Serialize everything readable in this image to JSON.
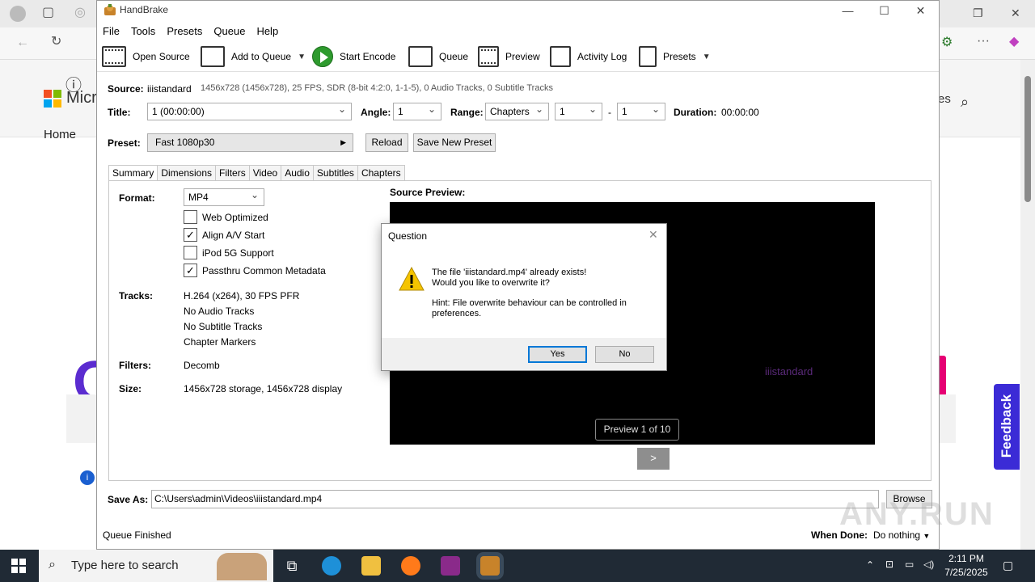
{
  "browser": {
    "home_link": "Home",
    "ms_text": "Micr",
    "es_text": "es",
    "feedback": "Feedback"
  },
  "window": {
    "title": "HandBrake"
  },
  "menu": [
    "File",
    "Tools",
    "Presets",
    "Queue",
    "Help"
  ],
  "toolbar": {
    "open_source": "Open Source",
    "add_to_queue": "Add to Queue",
    "start_encode": "Start Encode",
    "queue": "Queue",
    "preview": "Preview",
    "activity_log": "Activity Log",
    "presets": "Presets"
  },
  "source": {
    "label": "Source:",
    "name": "iiistandard",
    "details": "1456x728 (1456x728), 25 FPS, SDR (8-bit 4:2:0, 1-1-5), 0 Audio Tracks, 0 Subtitle Tracks"
  },
  "title_row": {
    "title_label": "Title:",
    "title_value": "1  (00:00:00)",
    "angle_label": "Angle:",
    "angle_value": "1",
    "range_label": "Range:",
    "range_value": "Chapters",
    "range_start": "1",
    "range_sep": "-",
    "range_end": "1",
    "duration_label": "Duration:",
    "duration_value": "00:00:00"
  },
  "preset": {
    "label": "Preset:",
    "value": "Fast 1080p30",
    "reload": "Reload",
    "save_new": "Save New Preset"
  },
  "tabs": [
    "Summary",
    "Dimensions",
    "Filters",
    "Video",
    "Audio",
    "Subtitles",
    "Chapters"
  ],
  "summary": {
    "format_label": "Format:",
    "format_value": "MP4",
    "checkboxes": [
      {
        "label": "Web Optimized",
        "checked": false,
        "mark": ""
      },
      {
        "label": "Align A/V Start",
        "checked": true,
        "mark": "✓"
      },
      {
        "label": "iPod 5G Support",
        "checked": false,
        "mark": ""
      },
      {
        "label": "Passthru Common Metadata",
        "checked": true,
        "mark": "✓"
      }
    ],
    "tracks_label": "Tracks:",
    "tracks": [
      "H.264 (x264), 30 FPS PFR",
      "No Audio Tracks",
      "No Subtitle Tracks",
      "Chapter Markers"
    ],
    "filters_label": "Filters:",
    "filters_value": "Decomb",
    "size_label": "Size:",
    "size_value": "1456x728 storage, 1456x728 display",
    "source_preview_label": "Source Preview:",
    "preview_watermark": "iiistandard",
    "preview_counter": "Preview 1 of 10",
    "next_label": ">"
  },
  "save_as": {
    "label": "Save As:",
    "value": "C:\\Users\\admin\\Videos\\iiistandard.mp4",
    "browse": "Browse"
  },
  "status": {
    "text": "Queue Finished",
    "when_done_label": "When Done:",
    "when_done_value": "Do nothing"
  },
  "dialog": {
    "title": "Question",
    "line1": "The file 'iiistandard.mp4' already exists!",
    "line2": "Would you like to overwrite it?",
    "hint": "Hint: File overwrite behaviour can be controlled in preferences.",
    "yes": "Yes",
    "no": "No"
  },
  "taskbar": {
    "search_placeholder": "Type here to search",
    "time": "2:11 PM",
    "date": "7/25/2025"
  },
  "watermark": "ANY.RUN",
  "colors": {
    "accent": "#0078d7",
    "taskbar": "#202a35",
    "encode_green": "#2e9a2e",
    "feedback": "#3b2bd6"
  }
}
